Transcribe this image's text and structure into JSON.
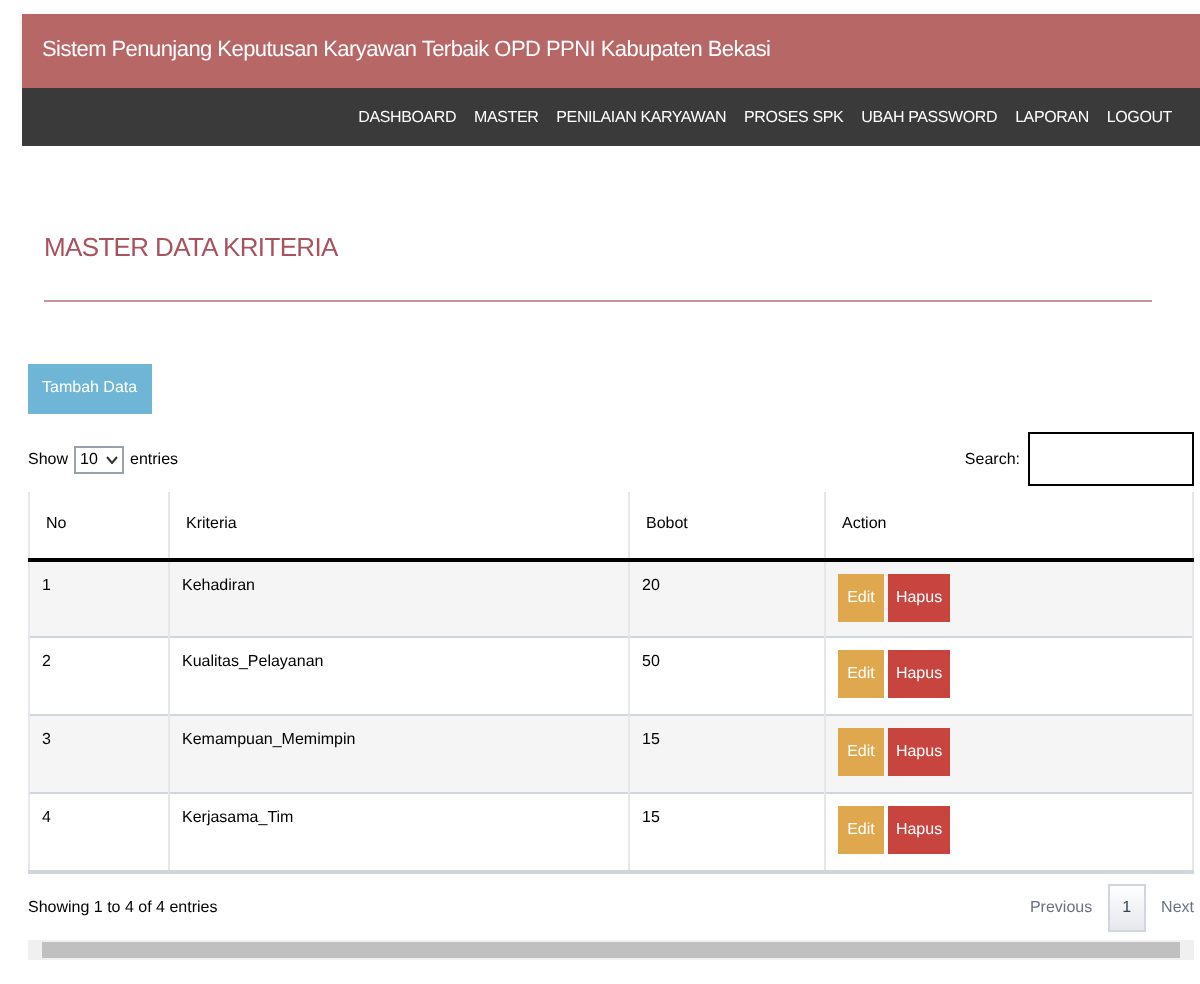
{
  "header": {
    "title": "Sistem Penunjang Keputusan Karyawan Terbaik OPD PPNI Kabupaten Bekasi"
  },
  "nav": [
    "DASHBOARD",
    "MASTER",
    "PENILAIAN KARYAWAN",
    "PROSES SPK",
    "UBAH PASSWORD",
    "LAPORAN",
    "LOGOUT"
  ],
  "page_title": "MASTER DATA KRITERIA",
  "add_button": "Tambah Data",
  "length_control": {
    "show": "Show",
    "value": "10",
    "entries": "entries"
  },
  "search": {
    "label": "Search:"
  },
  "table": {
    "columns": [
      "No",
      "Kriteria",
      "Bobot",
      "Action"
    ],
    "rows": [
      {
        "no": "1",
        "kriteria": "Kehadiran",
        "bobot": "20",
        "actions": [
          "Edit",
          "Hapus"
        ]
      },
      {
        "no": "2",
        "kriteria": "Kualitas_Pelayanan",
        "bobot": "50",
        "actions": [
          "Edit",
          "Hapus"
        ]
      },
      {
        "no": "3",
        "kriteria": "Kemampuan_Memimpin",
        "bobot": "15",
        "actions": [
          "Edit",
          "Hapus"
        ]
      },
      {
        "no": "4",
        "kriteria": "Kerjasama_Tim",
        "bobot": "15",
        "actions": [
          "Edit",
          "Hapus"
        ]
      }
    ]
  },
  "info": "Showing 1 to 4 of 4 entries",
  "pagination": {
    "previous": "Previous",
    "pages": [
      {
        "label": "1",
        "selected": true
      }
    ],
    "next": "Next"
  }
}
